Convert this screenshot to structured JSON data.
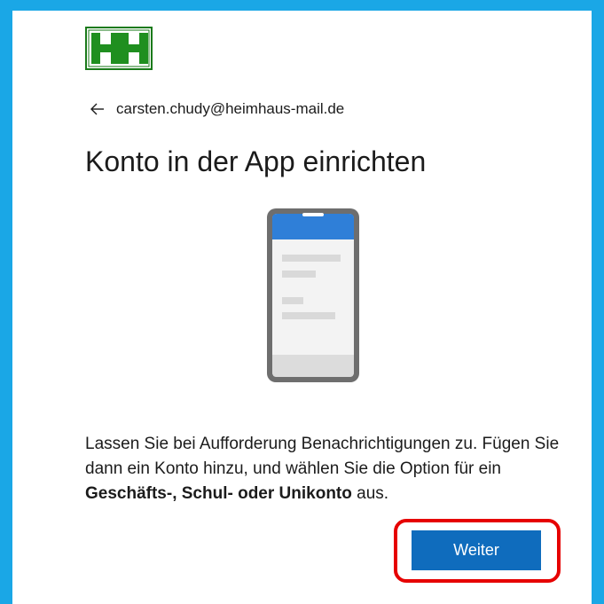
{
  "logo": {
    "text": "HH",
    "icon": "heimhaus-logo-icon"
  },
  "account": {
    "email": "carsten.chudy@heimhaus-mail.de",
    "back_icon": "back-arrow-icon"
  },
  "page": {
    "title": "Konto in der App einrichten"
  },
  "illustration": {
    "icon": "phone-illustration-icon"
  },
  "description": {
    "part1": "Lassen Sie bei Aufforderung Benachrichtigungen zu. Fügen Sie dann ein Konto hinzu, und wählen Sie die Option für ein ",
    "bold": "Geschäfts-, Schul- oder Unikonto",
    "part2": " aus."
  },
  "actions": {
    "next_label": "Weiter"
  },
  "colors": {
    "frame": "#1aa7e6",
    "primary_button": "#0f6cbd",
    "highlight": "#e60000",
    "logo_green": "#1f8f1f"
  }
}
